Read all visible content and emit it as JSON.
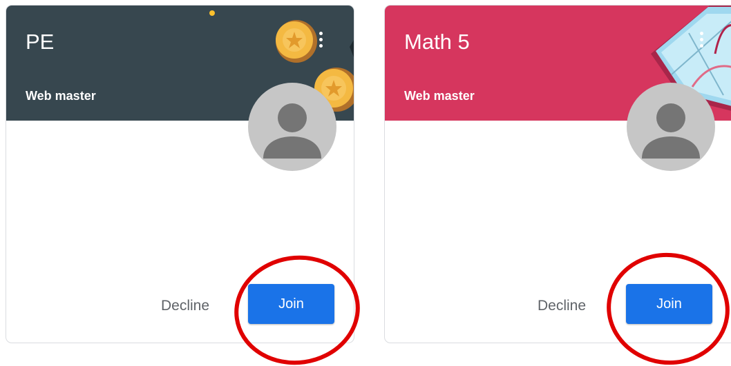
{
  "cards": [
    {
      "title": "PE",
      "subtitle": "Web master",
      "banner_color": "#37474f",
      "decline_label": "Decline",
      "join_label": "Join"
    },
    {
      "title": "Math 5",
      "subtitle": "Web master",
      "banner_color": "#d6365e",
      "decline_label": "Decline",
      "join_label": "Join"
    }
  ],
  "colors": {
    "join_button": "#1a73e8",
    "highlight_ring": "#e00000",
    "card_border": "#dadce0"
  },
  "icons": [
    "more-vert-icon",
    "default-avatar-icon",
    "coin-illustration",
    "geometry-illustration"
  ]
}
